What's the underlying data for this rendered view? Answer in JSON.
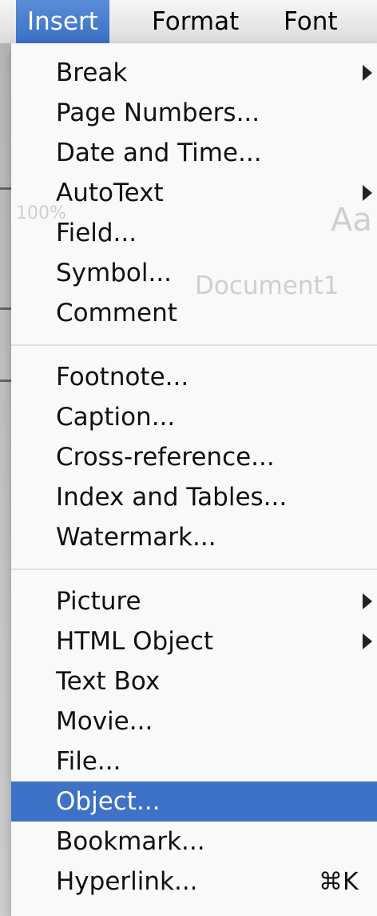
{
  "menubar": {
    "items": [
      {
        "label": "Insert",
        "active": true
      },
      {
        "label": "Format",
        "active": false
      },
      {
        "label": "Font",
        "active": false
      }
    ]
  },
  "background_ghost": {
    "zoom": "100%",
    "document_title": "Document1",
    "aa": "Aa"
  },
  "colors": {
    "selection": "#3d72c6",
    "menu_bg": "#fafafa"
  },
  "menu": {
    "groups": [
      [
        {
          "label": "Break",
          "submenu": true
        },
        {
          "label": "Page Numbers...",
          "submenu": false
        },
        {
          "label": "Date and Time...",
          "submenu": false
        },
        {
          "label": "AutoText",
          "submenu": true
        },
        {
          "label": "Field...",
          "submenu": false
        },
        {
          "label": "Symbol...",
          "submenu": false
        },
        {
          "label": "Comment",
          "submenu": false
        }
      ],
      [
        {
          "label": "Footnote...",
          "submenu": false
        },
        {
          "label": "Caption...",
          "submenu": false
        },
        {
          "label": "Cross-reference...",
          "submenu": false
        },
        {
          "label": "Index and Tables...",
          "submenu": false
        },
        {
          "label": "Watermark...",
          "submenu": false
        }
      ],
      [
        {
          "label": "Picture",
          "submenu": true
        },
        {
          "label": "HTML Object",
          "submenu": true
        },
        {
          "label": "Text Box",
          "submenu": false
        },
        {
          "label": "Movie...",
          "submenu": false
        },
        {
          "label": "File...",
          "submenu": false
        },
        {
          "label": "Object...",
          "submenu": false,
          "selected": true
        },
        {
          "label": "Bookmark...",
          "submenu": false
        },
        {
          "label": "Hyperlink...",
          "submenu": false,
          "shortcut": "⌘K"
        }
      ]
    ]
  }
}
